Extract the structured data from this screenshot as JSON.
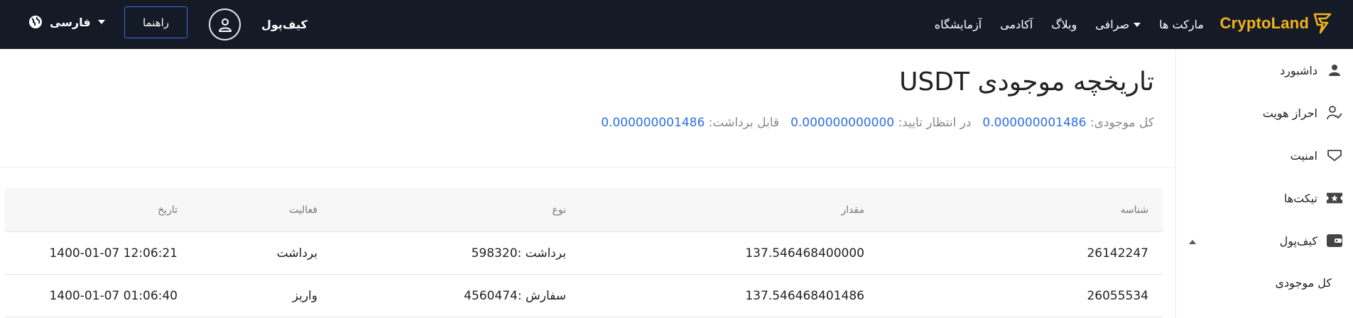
{
  "topbar": {
    "logo": "CryptoLand",
    "nav": [
      "مارکت ها",
      "صرافی",
      "وبلاگ",
      "آکادمی",
      "آزمایشگاه"
    ],
    "wallet": "کیف‌پول",
    "guide_button": "راهنما",
    "language": "فارسی"
  },
  "sidebar": {
    "items": [
      {
        "label": "داشبورد",
        "icon": "person-icon"
      },
      {
        "label": "احراز هویت",
        "icon": "user-check-icon"
      },
      {
        "label": "امنیت",
        "icon": "shield-icon"
      },
      {
        "label": "تیکت‌ها",
        "icon": "ticket-icon"
      },
      {
        "label": "کیف‌پول",
        "icon": "wallet-icon"
      }
    ],
    "subitem": "کل موجودی"
  },
  "page": {
    "title": "تاریخچه موجودی USDT",
    "total_label": "کل موجودی:",
    "total_value": "0.000000001486",
    "pending_label": "در انتظار تایید:",
    "pending_value": "0.000000000000",
    "withdrawable_label": "قابل برداشت:",
    "withdrawable_value": "0.000000001486"
  },
  "table": {
    "headers": [
      "شناسه",
      "مقدار",
      "نوع",
      "فعالیت",
      "تاریخ"
    ],
    "rows": [
      {
        "id": "26142247",
        "amount": "137.546468400000",
        "type": "برداشت :598320",
        "activity": "برداشت",
        "date": "1400-01-07 12:06:21"
      },
      {
        "id": "26055534",
        "amount": "137.546468401486",
        "type": "سفارش :4560474",
        "activity": "واریز",
        "date": "1400-01-07 01:06:40"
      }
    ]
  },
  "colors": {
    "topbar": "#141a26",
    "accent": "#f5b21b",
    "link": "#2f6fe3"
  }
}
